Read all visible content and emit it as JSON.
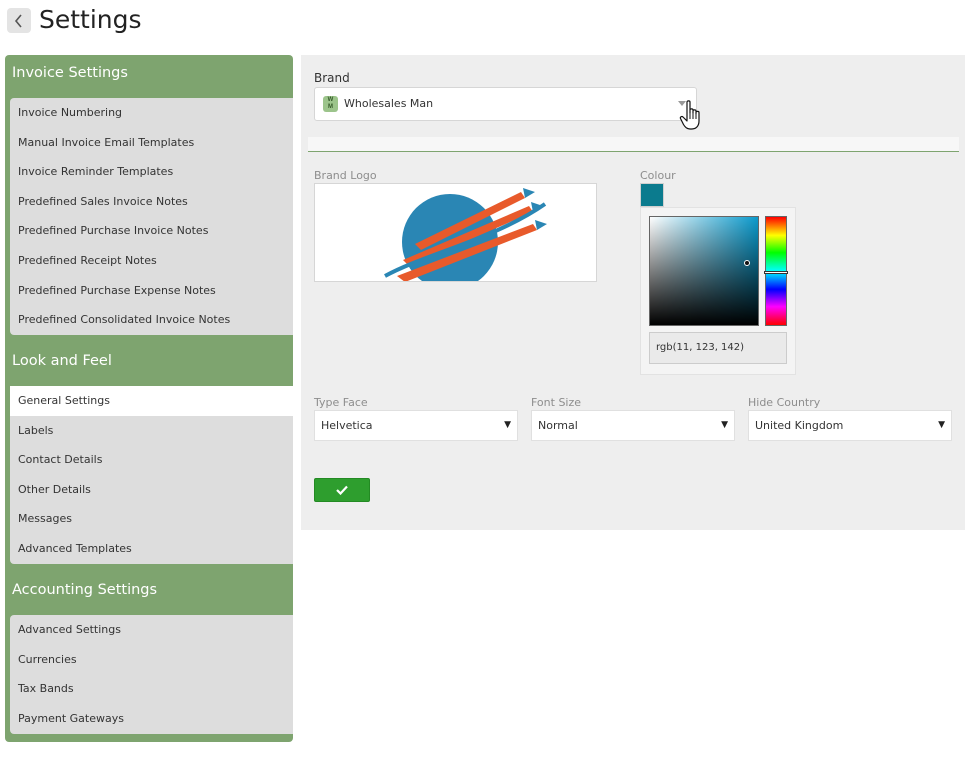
{
  "header": {
    "title": "Settings",
    "back_icon": "chevron-left-icon"
  },
  "sidebar": {
    "sections": [
      {
        "title": "Invoice Settings",
        "items": [
          "Invoice Numbering",
          "Manual Invoice Email Templates",
          "Invoice Reminder Templates",
          "Predefined Sales Invoice Notes",
          "Predefined Purchase Invoice Notes",
          "Predefined Receipt Notes",
          "Predefined Purchase Expense Notes",
          "Predefined Consolidated Invoice Notes"
        ]
      },
      {
        "title": "Look and Feel",
        "items": [
          "General Settings",
          "Labels",
          "Contact Details",
          "Other Details",
          "Messages",
          "Advanced Templates"
        ],
        "active_item": "General Settings"
      },
      {
        "title": "Accounting Settings",
        "items": [
          "Advanced Settings",
          "Currencies",
          "Tax Bands",
          "Payment Gateways"
        ]
      }
    ]
  },
  "main": {
    "brand_label": "Brand",
    "brand_badge": "WM",
    "brand_value": "Wholesales Man",
    "brand_logo_label": "Brand Logo",
    "colour_label": "Colour",
    "colour_hex": "#0b7b8e",
    "colour_rgb": "rgb(11, 123, 142)",
    "type_face_label": "Type Face",
    "type_face_value": "Helvetica",
    "font_size_label": "Font Size",
    "font_size_value": "Normal",
    "hide_country_label": "Hide Country",
    "hide_country_value": "United Kingdom",
    "save_icon": "checkmark-icon",
    "caret_glyph": "▼"
  },
  "colors": {
    "sidebar_green": "#7ea46f",
    "save_green": "#2e9e2e",
    "panel_grey": "#eeeeee"
  }
}
